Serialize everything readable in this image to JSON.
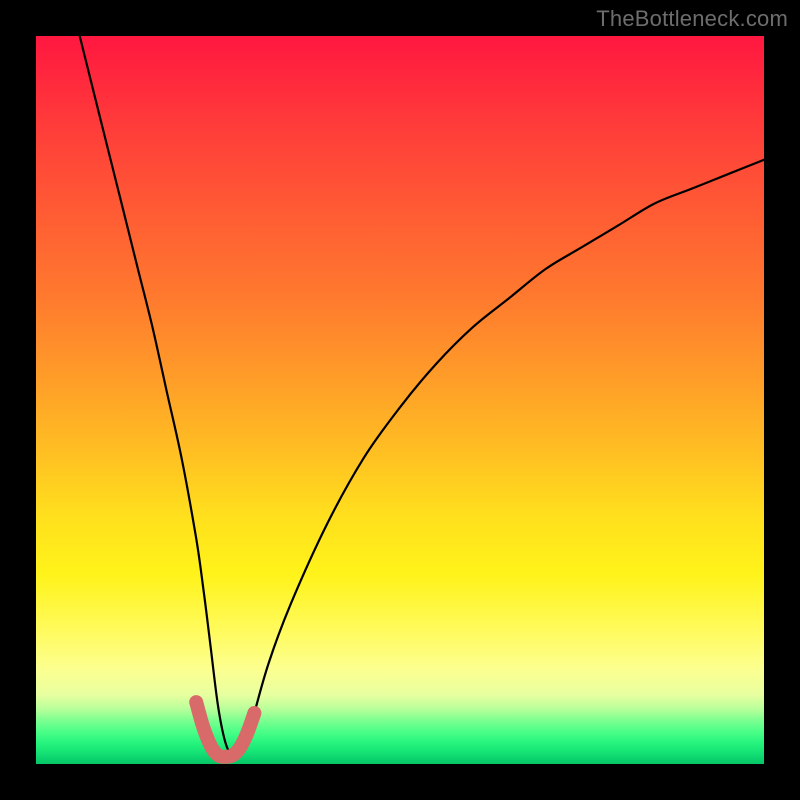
{
  "watermark": "TheBottleneck.com",
  "chart_data": {
    "type": "line",
    "title": "",
    "xlabel": "",
    "ylabel": "",
    "xlim": [
      0,
      100
    ],
    "ylim": [
      0,
      100
    ],
    "grid": false,
    "legend": false,
    "series": [
      {
        "name": "bottleneck-curve",
        "color": "#000000",
        "x": [
          6,
          8,
          10,
          12,
          14,
          16,
          18,
          20,
          22,
          23,
          24,
          25,
          26,
          27,
          28,
          29,
          30,
          32,
          35,
          40,
          45,
          50,
          55,
          60,
          65,
          70,
          75,
          80,
          85,
          90,
          95,
          100
        ],
        "y": [
          100,
          92,
          84,
          76,
          68,
          60,
          51,
          42,
          31,
          24,
          16,
          8,
          3,
          1,
          1,
          3,
          7,
          14,
          22,
          33,
          42,
          49,
          55,
          60,
          64,
          68,
          71,
          74,
          77,
          79,
          81,
          83
        ]
      },
      {
        "name": "optimal-band",
        "color": "#d86a6a",
        "x": [
          22.0,
          23.0,
          24.0,
          25.0,
          26.0,
          27.0,
          28.0,
          29.0,
          30.0
        ],
        "y": [
          8.5,
          5.0,
          2.5,
          1.2,
          1.0,
          1.2,
          2.2,
          4.2,
          7.0
        ]
      }
    ],
    "gradient_stops": [
      {
        "pos": 0.0,
        "color": "#ff1740"
      },
      {
        "pos": 0.5,
        "color": "#ffb525"
      },
      {
        "pos": 0.78,
        "color": "#fff840"
      },
      {
        "pos": 0.92,
        "color": "#b6ff9a"
      },
      {
        "pos": 1.0,
        "color": "#06c566"
      }
    ]
  }
}
